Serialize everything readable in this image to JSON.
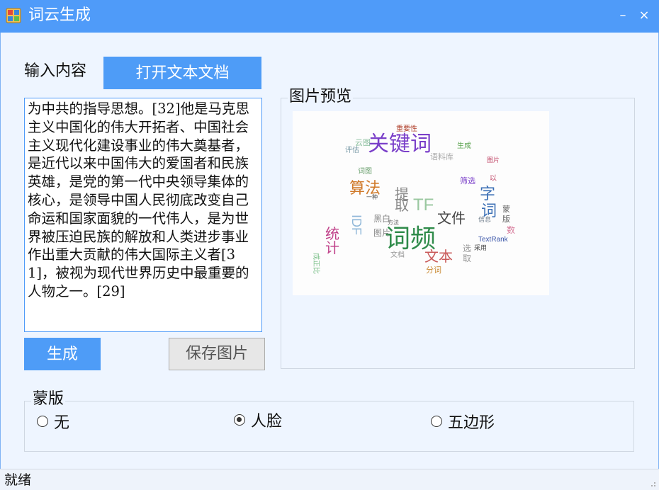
{
  "window": {
    "title": "词云生成",
    "icons": {
      "app": "app-window-icon",
      "minimize": "minimize-icon",
      "close": "close-icon"
    },
    "minimize_glyph": "–",
    "close_glyph": "×"
  },
  "input": {
    "label": "输入内容",
    "open_button": "打开文本文档",
    "text": "为中共的指导思想。[32]他是马克思主义中国化的伟大开拓者、中国社会主义现代化建设事业的伟大奠基者，是近代以来中国伟大的爱国者和民族英雄，是党的第一代中央领导集体的核心，是领导中国人民彻底改变自己命运和国家面貌的一代伟人，是为世界被压迫民族的解放和人类进步事业作出重大贡献的伟大国际主义者[31]，被视为现代世界历史中最重要的人物之一。[29]"
  },
  "buttons": {
    "generate": "生成",
    "save": "保存图片"
  },
  "preview": {
    "title": "图片预览",
    "words": [
      "关键词",
      "词频",
      "算法",
      "文件",
      "文本",
      "字",
      "词",
      "TF",
      "IDF",
      "统",
      "计",
      "提",
      "取",
      "重要性",
      "云图",
      "评估",
      "生成",
      "语料库",
      "词图",
      "筛选",
      "图片",
      "TextRank",
      "蒙",
      "版",
      "分词",
      "采用",
      "黑白",
      "图片",
      "信息",
      "方法",
      "一种",
      "文档",
      "成正比",
      "以",
      "数",
      "选",
      "取"
    ]
  },
  "mask": {
    "title": "蒙版",
    "options": [
      {
        "label": "无",
        "checked": false
      },
      {
        "label": "人脸",
        "checked": true
      },
      {
        "label": "五边形",
        "checked": false
      }
    ]
  },
  "status": {
    "text": "就绪"
  },
  "colors": {
    "titlebar": "#4f9bf9",
    "button": "#4e9cf7",
    "window_bg": "#eef5ff"
  }
}
